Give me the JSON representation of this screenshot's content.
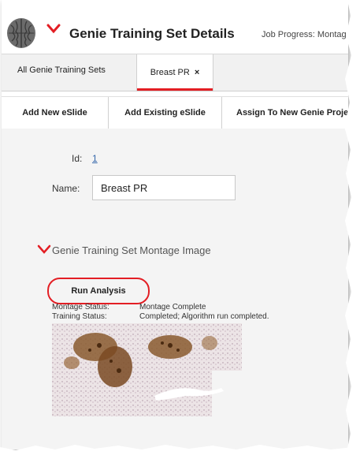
{
  "header": {
    "title": "Genie Training Set Details",
    "job_progress": "Job Progress: Montag"
  },
  "tabs": [
    {
      "label": "All Genie Training Sets",
      "active": false
    },
    {
      "label": "Breast PR",
      "active": true,
      "close": "×"
    }
  ],
  "toolbar": {
    "add_new": "Add New eSlide",
    "add_existing": "Add Existing eSlide",
    "assign": "Assign To New Genie Proje"
  },
  "form": {
    "id_label": "Id:",
    "id_value": "1",
    "name_label": "Name:",
    "name_value": "Breast PR"
  },
  "section": {
    "title": "Genie Training Set Montage Image",
    "run_button": "Run Analysis",
    "montage_status_label": "Montage Status:",
    "montage_status_value": "Montage Complete",
    "training_status_label": "Training Status:",
    "training_status_value": "Completed; Algorithm run completed."
  },
  "colors": {
    "accent_red": "#e31e24",
    "link_blue": "#3366aa"
  },
  "icons": [
    "brain-logo-icon",
    "chevron-down-icon",
    "close-icon",
    "section-chevron-icon"
  ]
}
